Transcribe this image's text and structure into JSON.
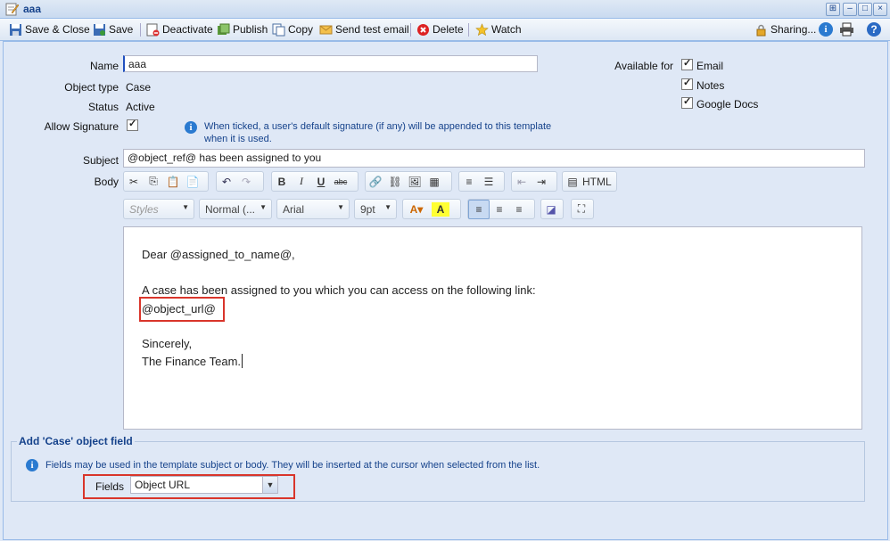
{
  "window": {
    "title": "aaa"
  },
  "toolbar": {
    "save_close": "Save & Close",
    "save": "Save",
    "deactivate": "Deactivate",
    "publish": "Publish",
    "copy": "Copy",
    "send_test": "Send test email",
    "delete": "Delete",
    "watch": "Watch",
    "sharing": "Sharing..."
  },
  "form": {
    "name_label": "Name",
    "name_value": "aaa",
    "object_type_label": "Object type",
    "object_type_value": "Case",
    "status_label": "Status",
    "status_value": "Active",
    "allow_signature_label": "Allow Signature",
    "allow_signature_checked": true,
    "signature_info_line1": "When ticked, a user's default signature (if any) will be appended to this template",
    "signature_info_line2": "when it is used.",
    "available_for_label": "Available for",
    "available_email": "Email",
    "available_notes": "Notes",
    "available_gdocs": "Google Docs",
    "subject_label": "Subject",
    "subject_value": "@object_ref@ has been assigned to you",
    "body_label": "Body"
  },
  "editor_toolbar": {
    "html_label": "HTML",
    "styles": "Styles",
    "format": "Normal (...",
    "font": "Arial",
    "size": "9pt"
  },
  "body_text": {
    "line1": "Dear @assigned_to_name@,",
    "line2": "A case has been assigned to you which you can access on the following link:",
    "line3": "@object_url@",
    "line4": "Sincerely,",
    "line5": "The Finance Team."
  },
  "object_field": {
    "legend": "Add 'Case' object field",
    "info": "Fields may be used in the template subject or body. They will be inserted at the cursor when selected from the list.",
    "fields_label": "Fields",
    "fields_value": "Object URL"
  },
  "colors": {
    "highlight": "#d9352b",
    "accent": "#15428b",
    "panel": "#dfe8f6"
  }
}
